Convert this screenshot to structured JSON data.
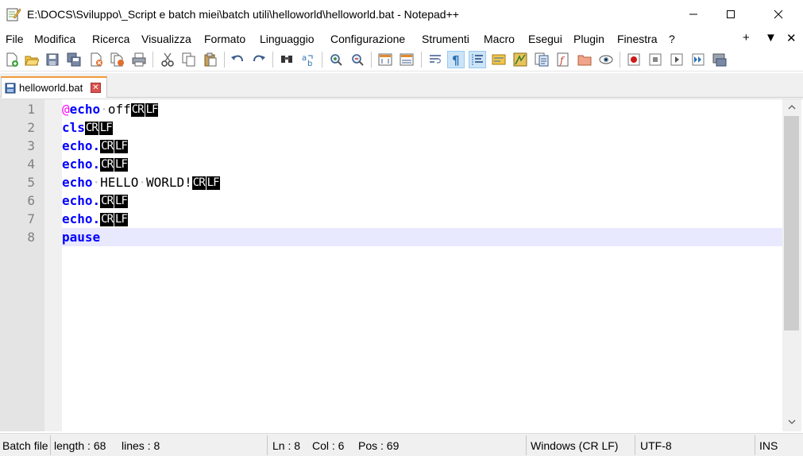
{
  "window": {
    "title": "E:\\DOCS\\Sviluppo\\_Script e batch miei\\batch utili\\helloworld\\helloworld.bat - Notepad++",
    "app_icon": "notepad-plus-plus-icon"
  },
  "menu": {
    "items": [
      "File",
      "Modifica",
      "Ricerca",
      "Visualizza",
      "Formato",
      "Linguaggio",
      "Configurazione",
      "Strumenti",
      "Macro",
      "Esegui",
      "Plugin",
      "Finestra",
      "?"
    ],
    "right": [
      "+",
      "▼",
      "✕"
    ]
  },
  "toolbar": {
    "icons": [
      "new-file-icon",
      "open-file-icon",
      "save-icon",
      "save-all-icon",
      "close-icon",
      "close-all-icon",
      "print-icon",
      "cut-icon",
      "copy-icon",
      "paste-icon",
      "undo-icon",
      "redo-icon",
      "find-icon",
      "replace-icon",
      "zoom-in-icon",
      "zoom-out-icon",
      "sync-vertical-icon",
      "sync-horizontal-icon",
      "word-wrap-icon",
      "show-all-characters-icon",
      "indent-guide-icon",
      "user-defined-language-icon",
      "document-map-icon",
      "function-list-icon",
      "folder-as-workspace-icon",
      "monitoring-icon",
      "record-macro-icon",
      "stop-macro-icon",
      "play-macro-icon",
      "run-macro-multiple-icon",
      "save-macro-icon"
    ]
  },
  "tabs": [
    {
      "label": "helloworld.bat",
      "active": true
    }
  ],
  "editor": {
    "line_numbers": [
      "1",
      "2",
      "3",
      "4",
      "5",
      "6",
      "7",
      "8"
    ],
    "lines": [
      {
        "prefix": "@",
        "keyword": "echo",
        "rest_dot": "·",
        "rest": "off",
        "eol": [
          "CR",
          "LF"
        ]
      },
      {
        "keyword": "cls",
        "eol": [
          "CR",
          "LF"
        ]
      },
      {
        "keyword": "echo.",
        "eol": [
          "CR",
          "LF"
        ]
      },
      {
        "keyword": "echo.",
        "eol": [
          "CR",
          "LF"
        ]
      },
      {
        "keyword": "echo",
        "rest_dot": "·",
        "rest": "HELLO",
        "rest_dot2": "·",
        "rest2": "WORLD!",
        "eol": [
          "CR",
          "LF"
        ]
      },
      {
        "keyword": "echo.",
        "eol": [
          "CR",
          "LF"
        ]
      },
      {
        "keyword": "echo.",
        "eol": [
          "CR",
          "LF"
        ]
      },
      {
        "keyword": "pause"
      }
    ],
    "current_line": 8
  },
  "status": {
    "filetype": "Batch file",
    "length": "length : 68",
    "lines": "lines : 8",
    "ln": "Ln : 8",
    "col": "Col : 6",
    "pos": "Pos : 69",
    "eol_mode": "Windows (CR LF)",
    "encoding": "UTF-8",
    "ins": "INS"
  },
  "colors": {
    "keyword": "#0000ff",
    "at_symbol": "#ff00ff",
    "current_line": "#e8e8ff",
    "tab_accent": "#f29a38"
  }
}
